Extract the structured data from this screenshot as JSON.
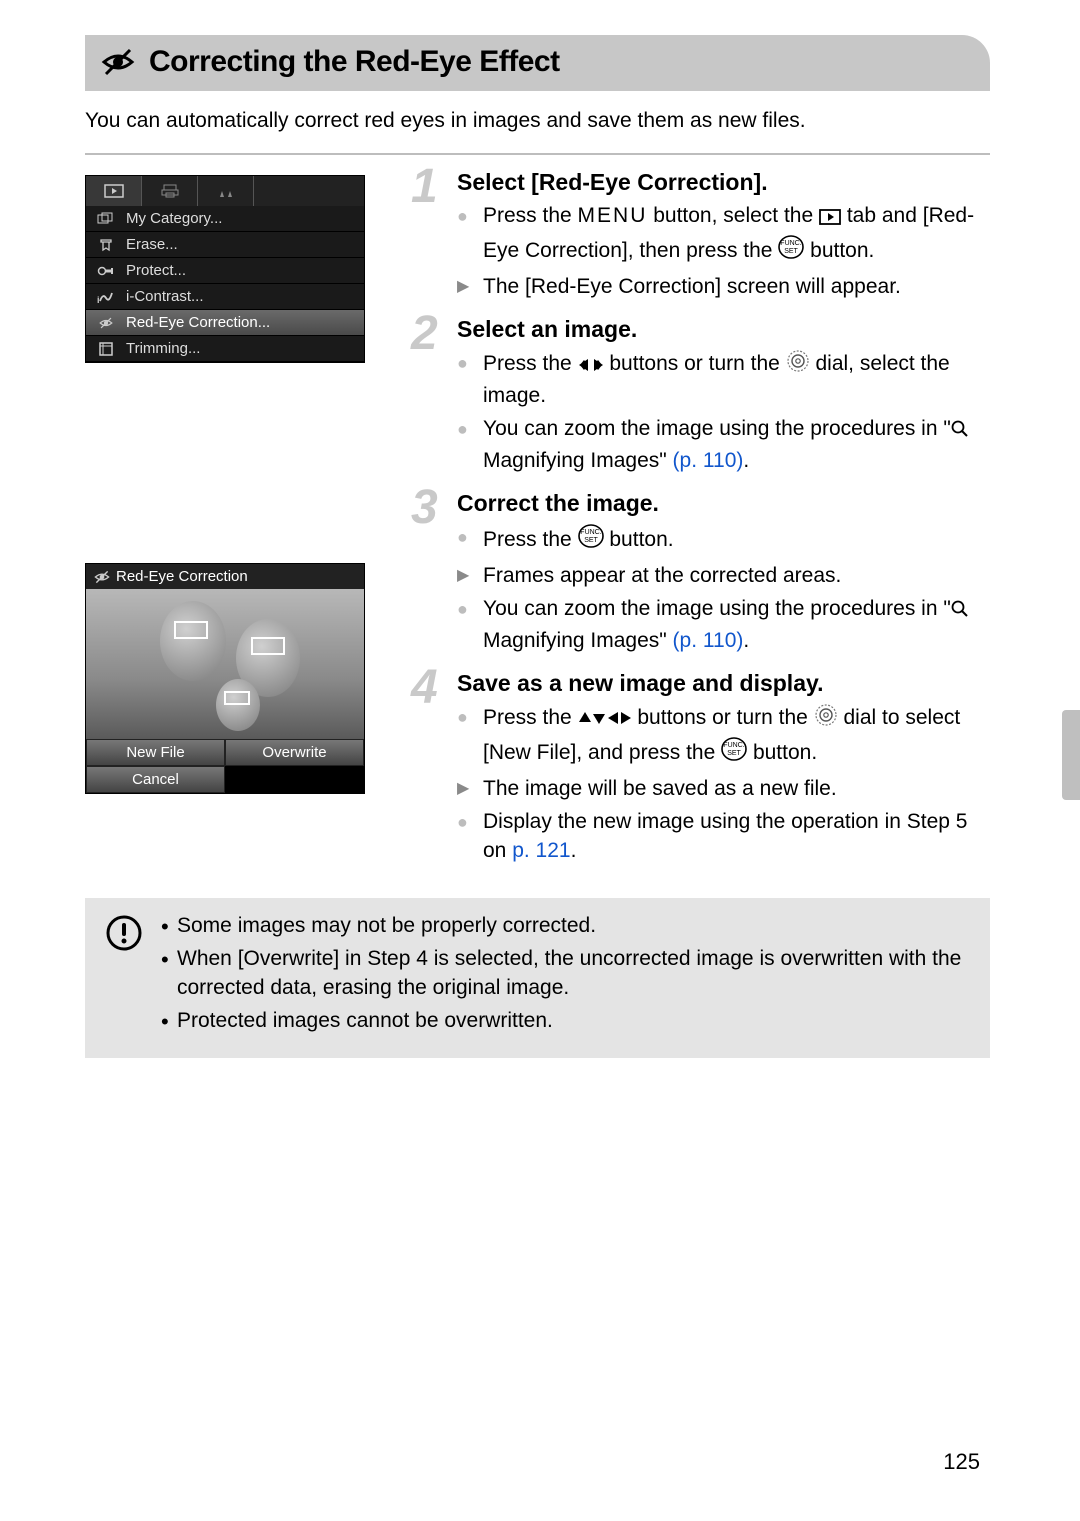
{
  "header": {
    "title": "Correcting the Red-Eye Effect"
  },
  "intro": "You can automatically correct red eyes in images and save them as new files.",
  "menu": {
    "items": [
      {
        "label": "My Category..."
      },
      {
        "label": "Erase..."
      },
      {
        "label": "Protect..."
      },
      {
        "label": "i-Contrast..."
      },
      {
        "label": "Red-Eye Correction..."
      },
      {
        "label": "Trimming..."
      }
    ]
  },
  "preview": {
    "title": "Red-Eye Correction",
    "buttons": {
      "new": "New File",
      "over": "Overwrite",
      "cancel": "Cancel"
    }
  },
  "steps": [
    {
      "num": "1",
      "title": "Select [Red-Eye Correction].",
      "items": [
        {
          "t": "bullet",
          "segments": [
            {
              "text": "Press the "
            },
            {
              "icon": "menu-word"
            },
            {
              "text": " button, select the "
            },
            {
              "icon": "play-tab"
            },
            {
              "text": " tab and [Red-Eye Correction], then press the "
            },
            {
              "icon": "func-set"
            },
            {
              "text": " button."
            }
          ]
        },
        {
          "t": "result",
          "segments": [
            {
              "text": "The [Red-Eye Correction] screen will appear."
            }
          ]
        }
      ]
    },
    {
      "num": "2",
      "title": "Select an image.",
      "items": [
        {
          "t": "bullet",
          "segments": [
            {
              "text": "Press the "
            },
            {
              "icon": "left-right"
            },
            {
              "text": " buttons or turn the "
            },
            {
              "icon": "dial"
            },
            {
              "text": " dial, select the image."
            }
          ]
        },
        {
          "t": "bullet",
          "segments": [
            {
              "text": "You can zoom the image using the procedures in \""
            },
            {
              "icon": "magnify"
            },
            {
              "text": " Magnifying Images\" "
            },
            {
              "link": "(p. 110)"
            },
            {
              "text": "."
            }
          ]
        }
      ]
    },
    {
      "num": "3",
      "title": "Correct the image.",
      "items": [
        {
          "t": "bullet",
          "segments": [
            {
              "text": "Press the "
            },
            {
              "icon": "func-set"
            },
            {
              "text": " button."
            }
          ]
        },
        {
          "t": "result",
          "segments": [
            {
              "text": "Frames appear at the corrected areas."
            }
          ]
        },
        {
          "t": "bullet",
          "segments": [
            {
              "text": "You can zoom the image using the procedures in \""
            },
            {
              "icon": "magnify"
            },
            {
              "text": " Magnifying Images\" "
            },
            {
              "link": "(p. 110)"
            },
            {
              "text": "."
            }
          ]
        }
      ]
    },
    {
      "num": "4",
      "title": "Save as a new image and display.",
      "items": [
        {
          "t": "bullet",
          "segments": [
            {
              "text": "Press the "
            },
            {
              "icon": "udlr"
            },
            {
              "text": " buttons or turn the "
            },
            {
              "icon": "dial"
            },
            {
              "text": " dial to select [New File], and press the "
            },
            {
              "icon": "func-set"
            },
            {
              "text": " button."
            }
          ]
        },
        {
          "t": "result",
          "segments": [
            {
              "text": "The image will be saved as a new file."
            }
          ]
        },
        {
          "t": "bullet",
          "segments": [
            {
              "text": "Display the new image using the operation in Step 5 on "
            },
            {
              "link": "p. 121"
            },
            {
              "text": "."
            }
          ]
        }
      ]
    }
  ],
  "caution": [
    "Some images may not be properly corrected.",
    "When [Overwrite] in Step 4 is selected, the uncorrected image is overwritten with the corrected data, erasing the original image.",
    "Protected images cannot be overwritten."
  ],
  "pageNumber": "125"
}
